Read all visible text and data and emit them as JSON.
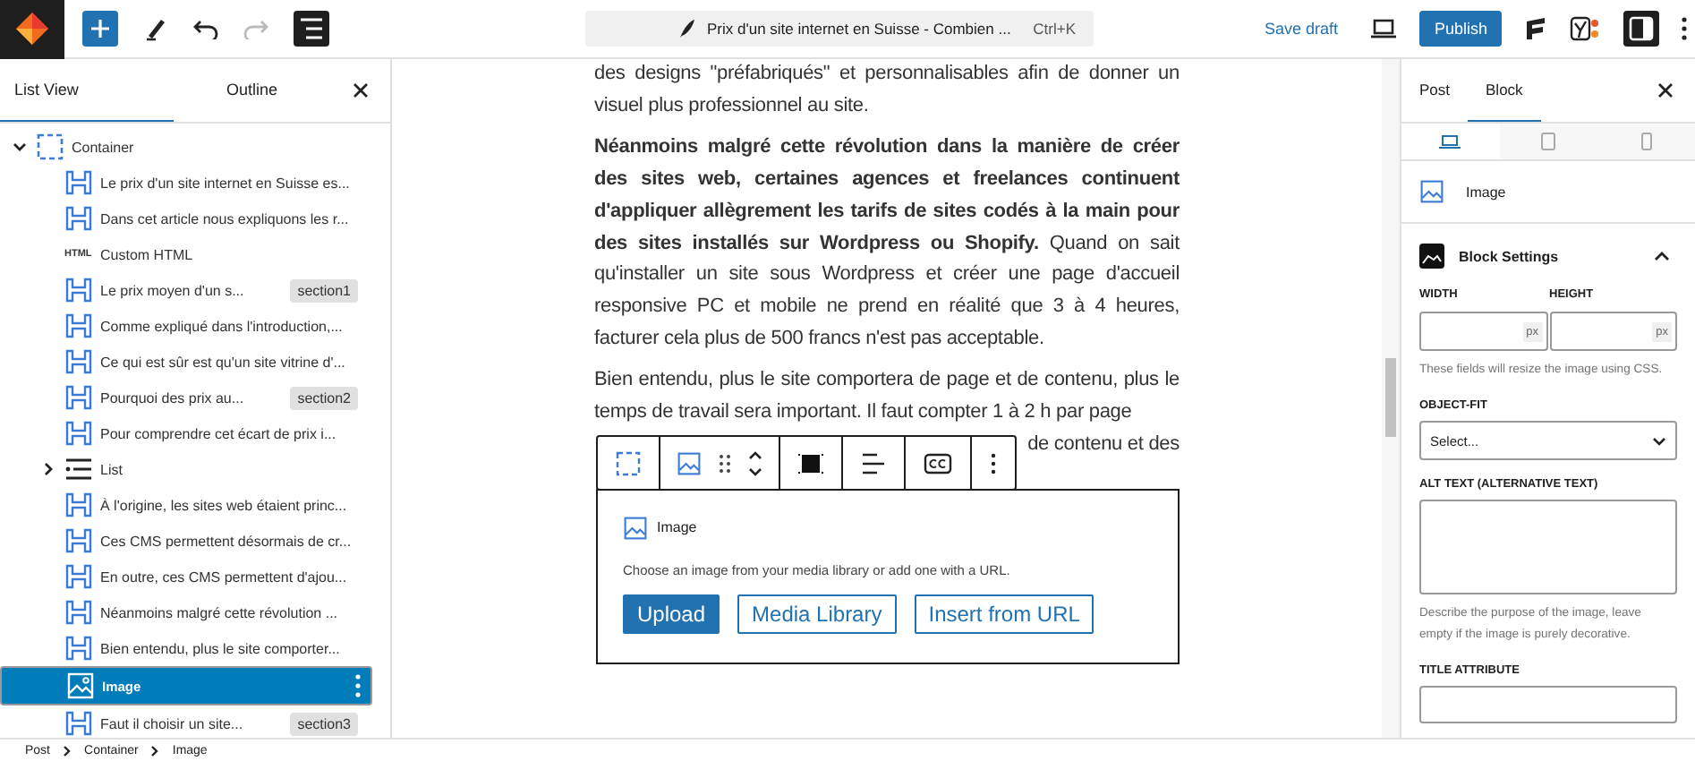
{
  "toolbar": {
    "title": "Prix d'un site internet en Suisse - Combien ...",
    "shortcut": "Ctrl+K",
    "save_label": "Save draft",
    "publish_label": "Publish",
    "redo_disabled": true,
    "list_view_on": true,
    "settings_on": true
  },
  "list_panel": {
    "tabs": [
      {
        "label": "List View",
        "selected": true
      },
      {
        "label": "Outline",
        "selected": false
      }
    ],
    "tree": [
      {
        "kind": "group",
        "label": "Container",
        "expanded": true,
        "selected": false,
        "children": [
          {
            "kind": "heading",
            "label": "Le prix d'un site internet en Suisse es...",
            "selected": false
          },
          {
            "kind": "heading",
            "label": "Dans cet article nous expliquons les r...",
            "selected": false
          },
          {
            "kind": "html",
            "icon_label": "HTML",
            "label": "Custom HTML",
            "selected": false
          },
          {
            "kind": "heading",
            "label": "Le prix moyen d'un s...",
            "badge": "section1",
            "selected": false
          },
          {
            "kind": "heading",
            "label": "Comme expliqué dans l'introduction,...",
            "selected": false
          },
          {
            "kind": "heading",
            "label": "Ce qui est sûr est qu'un site vitrine d'...",
            "selected": false
          },
          {
            "kind": "heading",
            "label": "Pourquoi des prix au...",
            "badge": "section2",
            "selected": false
          },
          {
            "kind": "heading",
            "label": "Pour comprendre cet écart de prix i...",
            "selected": false
          },
          {
            "kind": "list",
            "label": "List",
            "expanded": false,
            "selected": false
          },
          {
            "kind": "heading",
            "label": "À l'origine, les sites web étaient princ...",
            "selected": false
          },
          {
            "kind": "heading",
            "label": "Ces CMS permettent désormais de cr...",
            "selected": false
          },
          {
            "kind": "heading",
            "label": "En outre, ces CMS permettent d'ajou...",
            "selected": false
          },
          {
            "kind": "heading",
            "label": "Néanmoins malgré cette révolution ...",
            "selected": false
          },
          {
            "kind": "heading",
            "label": "Bien entendu, plus le site comporter...",
            "selected": false
          },
          {
            "kind": "image",
            "label": "Image",
            "selected": true
          },
          {
            "kind": "heading",
            "label": "Faut il choisir un site...",
            "badge": "section3",
            "selected": false
          }
        ]
      }
    ]
  },
  "editor": {
    "paragraphs": [
      "des designs \"préfabriqués\" et personnalisables afin de donner un visuel plus professionnel au site.",
      "**Néanmoins malgré cette révolution dans la manière de créer des sites web, certaines agences et freelances continuent d'appliquer allègrement les tarifs de sites codés à la main pour des sites installés sur Wordpress ou Shopify.** Quand on sait qu'installer un site sous Wordpress et créer une page d'accueil responsive PC et mobile ne prend en réalité que 3 à 4 heures, facturer cela plus de 500 francs n'est pas acceptable.",
      "Bien entendu, plus le site comportera de page et de contenu, plus le temps de travail sera important. Il faut compter 1 à 2 h par page"
    ],
    "covered_fragment": "de contenu et des",
    "image_block": {
      "title": "Image",
      "instructions": "Choose an image from your media library or add one with a URL.",
      "buttons": [
        {
          "label": "Upload",
          "kind": "primary"
        },
        {
          "label": "Media Library",
          "kind": "secondary"
        },
        {
          "label": "Insert from URL",
          "kind": "secondary"
        }
      ]
    }
  },
  "sidebar": {
    "tabs": [
      {
        "label": "Post",
        "selected": false
      },
      {
        "label": "Block",
        "selected": true
      }
    ],
    "devices": [
      {
        "kind": "desktop",
        "selected": true
      },
      {
        "kind": "tablet",
        "selected": false
      },
      {
        "kind": "mobile",
        "selected": false
      }
    ],
    "block_name": "Image",
    "settings": {
      "title": "Block Settings",
      "expanded": true,
      "width_label": "WIDTH",
      "height_label": "HEIGHT",
      "unit": "px",
      "unit_2": "px",
      "size_help": "These fields will resize the image using CSS.",
      "object_fit_label": "OBJECT-FIT",
      "object_fit_value": "Select...",
      "alt_label": "ALT TEXT (ALTERNATIVE TEXT)",
      "alt_help": "Describe the purpose of the image, leave empty if the image is purely decorative.",
      "title_label": "TITLE ATTRIBUTE"
    }
  },
  "breadcrumb": [
    "Post",
    "Container",
    "Image"
  ]
}
